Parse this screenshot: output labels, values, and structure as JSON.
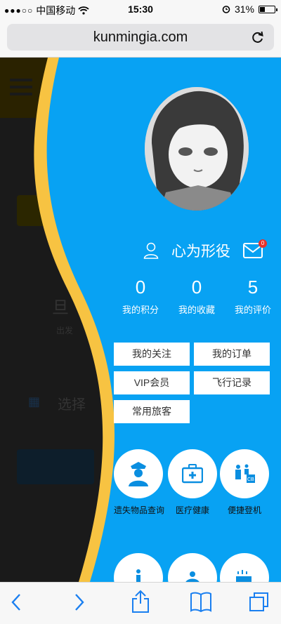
{
  "status_bar": {
    "carrier": "中国移动",
    "time": "15:30",
    "battery": "31%",
    "battery_level": 0.31
  },
  "browser": {
    "url": "kunmingia.com"
  },
  "background": {
    "text_1": "旦",
    "text_2": "出发",
    "text_3": "选择"
  },
  "drawer": {
    "username": "心为形役",
    "mail_badge": "0",
    "stats": [
      {
        "value": "0",
        "label": "我的积分"
      },
      {
        "value": "0",
        "label": "我的收藏"
      },
      {
        "value": "5",
        "label": "我的评价"
      }
    ],
    "buttons": [
      {
        "label": "我的关注"
      },
      {
        "label": "我的订单"
      },
      {
        "label": "VIP会员"
      },
      {
        "label": "飞行记录"
      },
      {
        "label": "常用旅客"
      }
    ],
    "services": [
      {
        "label": "遗失物品查询",
        "icon": "officer-icon"
      },
      {
        "label": "医疗健康",
        "icon": "medical-kit-icon"
      },
      {
        "label": "便捷登机",
        "icon": "boarding-icon"
      }
    ]
  },
  "colors": {
    "drawer_blue": "#08a2f3",
    "accent_yellow": "#f7c342",
    "icon_blue": "#0a8ee0"
  }
}
